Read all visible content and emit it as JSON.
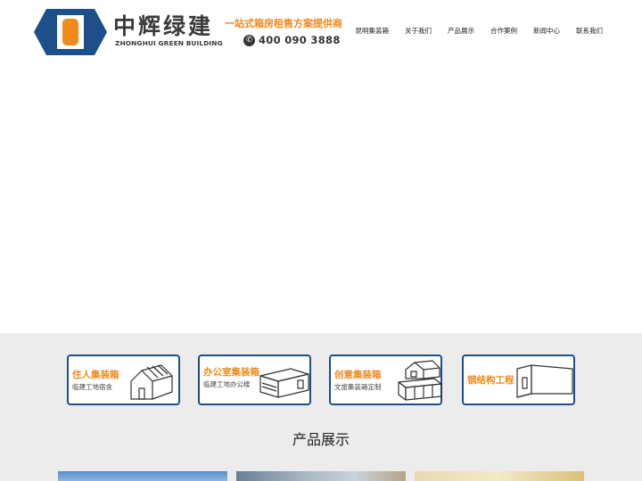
{
  "header": {
    "brand_cn": "中辉绿建",
    "brand_en": "ZHONGHUI GREEN BUILDING",
    "slogan": "一站式箱房租售方案提供商",
    "phone_icon": "✆",
    "phone": "400 090 3888"
  },
  "nav": {
    "items": [
      {
        "label": "昆明集装箱"
      },
      {
        "label": "关于我们"
      },
      {
        "label": "产品展示"
      },
      {
        "label": "合作案例"
      },
      {
        "label": "新闻中心"
      },
      {
        "label": "联系我们"
      }
    ]
  },
  "categories": [
    {
      "title": "住人集装箱",
      "subtitle": "临建工地宿舍",
      "icon": "house-icon"
    },
    {
      "title": "办公室集装箱",
      "subtitle": "临建工地办公楼",
      "icon": "office-container-icon"
    },
    {
      "title": "创意集装箱",
      "subtitle": "文旅集装箱定制",
      "icon": "creative-container-icon"
    },
    {
      "title": "钢结构工程",
      "subtitle": "",
      "icon": "steel-structure-icon"
    }
  ],
  "products": {
    "title": "产品展示"
  },
  "colors": {
    "brand_blue": "#1d4f8a",
    "accent_orange": "#f08a1c",
    "section_bg": "#ececec"
  }
}
